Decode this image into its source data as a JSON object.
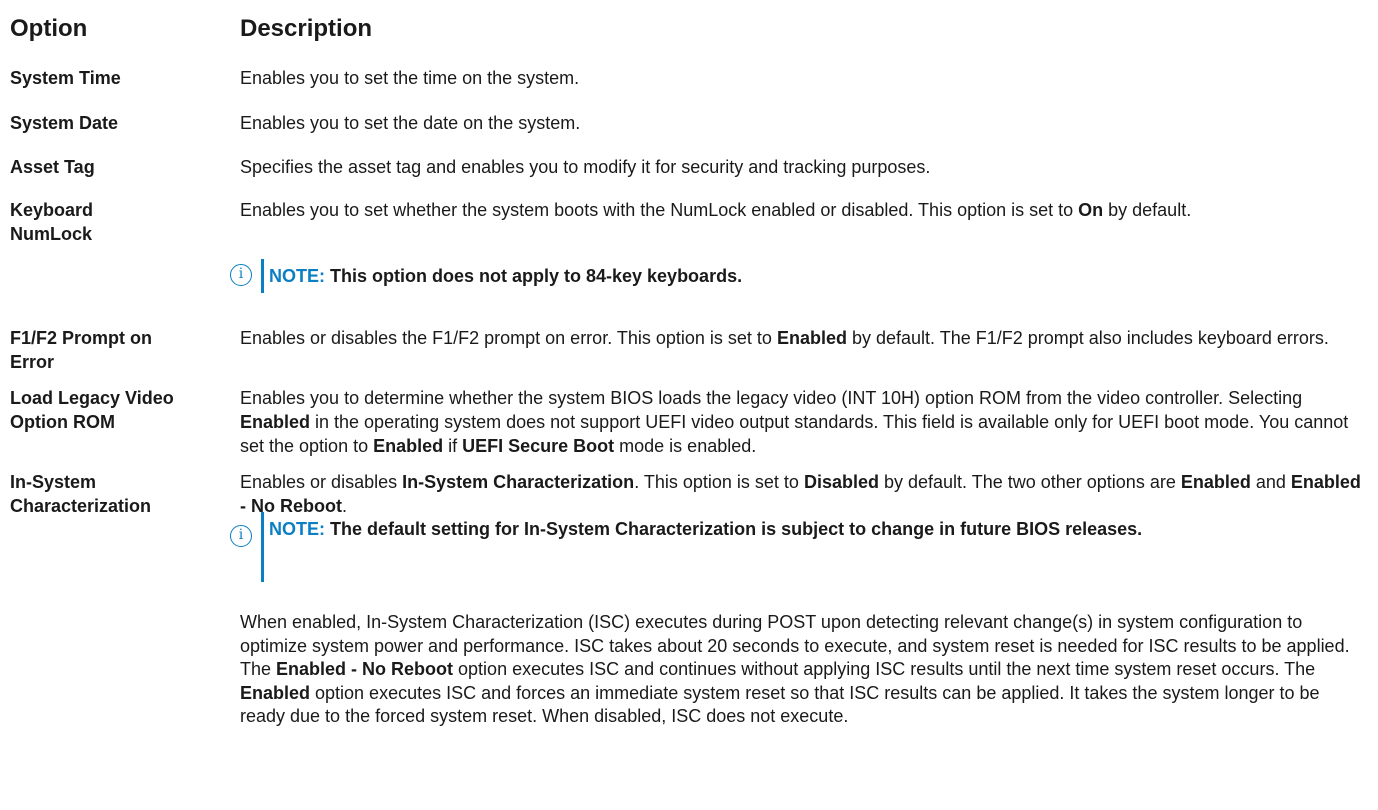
{
  "table": {
    "col_option": "Option",
    "col_description": "Description"
  },
  "rows": {
    "system_time": {
      "option": "System Time",
      "description": "Enables you to set the time on the system."
    },
    "system_date": {
      "option": "System Date",
      "description": "Enables you to set the date on the system."
    },
    "asset_tag": {
      "option": "Asset Tag",
      "description": "Specifies the asset tag and enables you to modify it for security and tracking purposes."
    },
    "numlock": {
      "option_line1": "Keyboard",
      "option_line2": "NumLock",
      "desc_a": "Enables you to set whether the system boots with the NumLock enabled or disabled. This option is set to ",
      "desc_b": "On",
      "desc_c": " by default.",
      "note_label": "NOTE:",
      "note_text": " This option does not apply to 84-key keyboards."
    },
    "f1f2": {
      "option_line1": "F1/F2 Prompt on",
      "option_line2": "Error",
      "desc_a": "Enables or disables the F1/F2 prompt on error. This option is set to ",
      "desc_b": "Enabled",
      "desc_c": " by default. The F1/F2 prompt also includes keyboard errors."
    },
    "legacy_video": {
      "option_line1": "Load Legacy Video",
      "option_line2": "Option ROM",
      "desc_a": "Enables you to determine whether the system BIOS loads the legacy video (INT 10H) option ROM from the video controller. Selecting ",
      "desc_b": "Enabled",
      "desc_c": " in the operating system does not support UEFI video output standards. This field is available only for UEFI boot mode. You cannot set the option to ",
      "desc_d": "Enabled",
      "desc_e": " if ",
      "desc_f": "UEFI Secure Boot",
      "desc_g": " mode is enabled."
    },
    "isc": {
      "option_line1": "In-System",
      "option_line2": "Characterization",
      "desc_a": "Enables or disables ",
      "desc_b": "In-System Characterization",
      "desc_c": ". This option is set to ",
      "desc_d": "Disabled",
      "desc_e": " by default. The two other options are ",
      "desc_f": "Enabled",
      "desc_g": " and ",
      "desc_h": "Enabled - No Reboot",
      "desc_i": ".",
      "note_label": "NOTE:",
      "note_text": " The default setting for In-System Characterization is subject to change in future BIOS releases.",
      "para_a": "When enabled, In-System Characterization (ISC) executes during POST upon detecting relevant change(s) in system configuration to optimize system power and performance. ISC takes about 20 seconds to execute, and system reset is needed for ISC results to be applied. The ",
      "para_b": "Enabled - No Reboot",
      "para_c": " option executes ISC and continues without applying ISC results until the next time system reset occurs. The ",
      "para_d": "Enabled",
      "para_e": " option executes ISC and forces an immediate system reset so that ISC results can be applied. It takes the system longer to be ready due to the forced system reset. When disabled, ISC does not execute."
    }
  },
  "icons": {
    "note": "info-circle-icon",
    "note_glyph": "i"
  },
  "colors": {
    "accent": "#0b7ec4",
    "text": "#1a1a1a"
  }
}
